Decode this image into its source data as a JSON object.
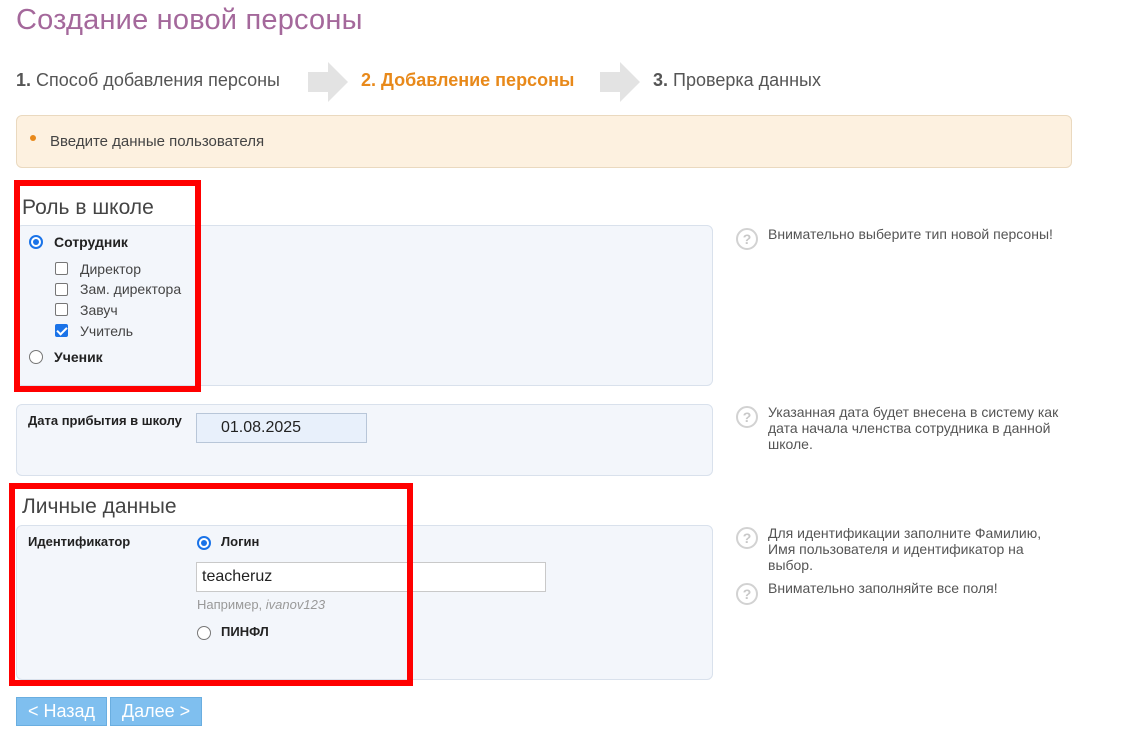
{
  "page": {
    "title": "Создание новой персоны"
  },
  "steps": [
    {
      "num": "1.",
      "label": "Способ добавления персоны"
    },
    {
      "num": "2.",
      "label": "Добавление персоны"
    },
    {
      "num": "3.",
      "label": "Проверка данных"
    }
  ],
  "notice": {
    "text": "Введите данные пользователя"
  },
  "role_section": {
    "title": "Роль в школе",
    "employee_label": "Сотрудник",
    "positions": [
      {
        "label": "Директор",
        "checked": false
      },
      {
        "label": "Зам. директора",
        "checked": false
      },
      {
        "label": "Завуч",
        "checked": false
      },
      {
        "label": "Учитель",
        "checked": true
      }
    ],
    "student_label": "Ученик",
    "selected": "Сотрудник",
    "help": "Внимательно выберите тип новой персоны!"
  },
  "arrival": {
    "label": "Дата прибытия в школу",
    "value": "01.08.2025",
    "help": "Указанная дата будет внесена в систему как дата начала членства сотрудника в данной школе."
  },
  "personal_section": {
    "title": "Личные данные",
    "identifier_label": "Идентификатор",
    "login_label": "Логин",
    "login_value": "teacheruz",
    "example_prefix": "Например,",
    "example_value": "ivanov123",
    "pinfl_label": "ПИНФЛ",
    "selected": "Логин",
    "help1": "Для идентификации заполните Фамилию, Имя пользователя и идентификатор на выбор.",
    "help2": "Внимательно заполняйте все поля!"
  },
  "buttons": {
    "back": "< Назад",
    "next": "Далее >"
  },
  "colors": {
    "title": "#a4689b",
    "active_step": "#e8891a",
    "accent": "#1a73e8",
    "highlight": "#ff0000",
    "button": "#7fbfef"
  },
  "icons": {
    "step_arrow": "arrow-right-icon",
    "help": "question-circle-icon"
  }
}
